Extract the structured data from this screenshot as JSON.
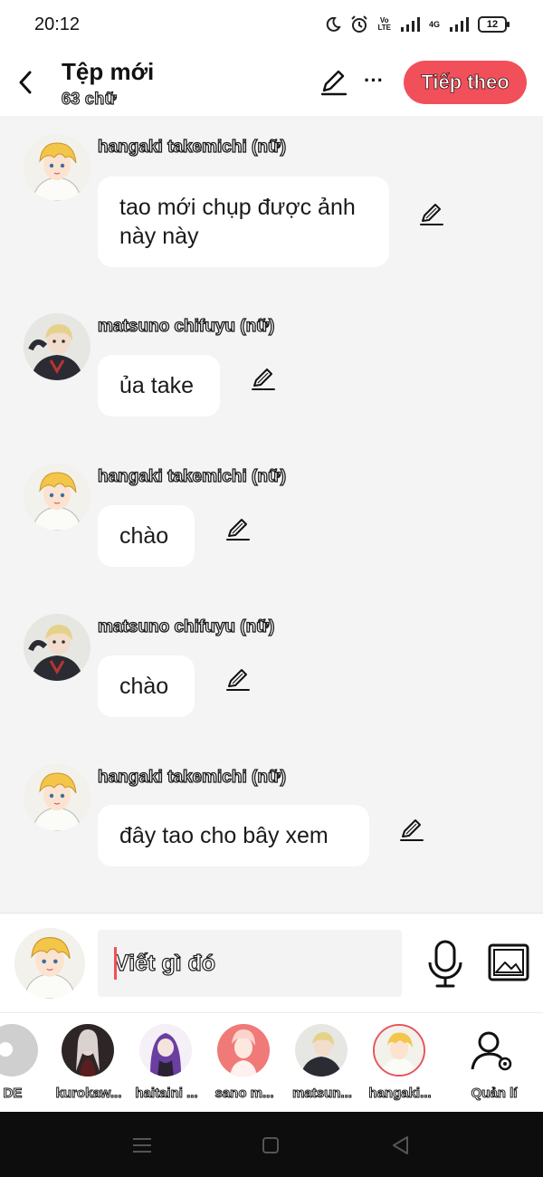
{
  "status_bar": {
    "time": "20:12",
    "battery": "12",
    "lte_line1": "Vo",
    "lte_line2": "LTE",
    "network": "4G"
  },
  "header": {
    "title": "Tệp mới",
    "word_count": "63 chữ",
    "more_label": "···",
    "next_label": "Tiếp theo"
  },
  "messages": [
    {
      "sender": "hangaki takemichi (nữ)",
      "text": "tao mới chụp được ảnh này này",
      "avatar": "takemichi"
    },
    {
      "sender": "matsuno chifuyu (nữ)",
      "text": "ủa take",
      "avatar": "chifuyu"
    },
    {
      "sender": "hangaki takemichi (nữ)",
      "text": "chào",
      "avatar": "takemichi"
    },
    {
      "sender": "matsuno chifuyu (nữ)",
      "text": "chào",
      "avatar": "chifuyu"
    },
    {
      "sender": "hangaki takemichi (nữ)",
      "text": "đây tao cho bây xem",
      "avatar": "takemichi"
    }
  ],
  "composer": {
    "placeholder": "Viết gì đó"
  },
  "characters": [
    {
      "label": "DE"
    },
    {
      "label": "kurokaw..."
    },
    {
      "label": "haitaini ..."
    },
    {
      "label": "sano m..."
    },
    {
      "label": "matsun..."
    },
    {
      "label": "hangaki..."
    }
  ],
  "manage_label": "Quản lí",
  "colors": {
    "accent": "#f1505a",
    "background": "#f4f4f4",
    "bubble": "#ffffff"
  }
}
